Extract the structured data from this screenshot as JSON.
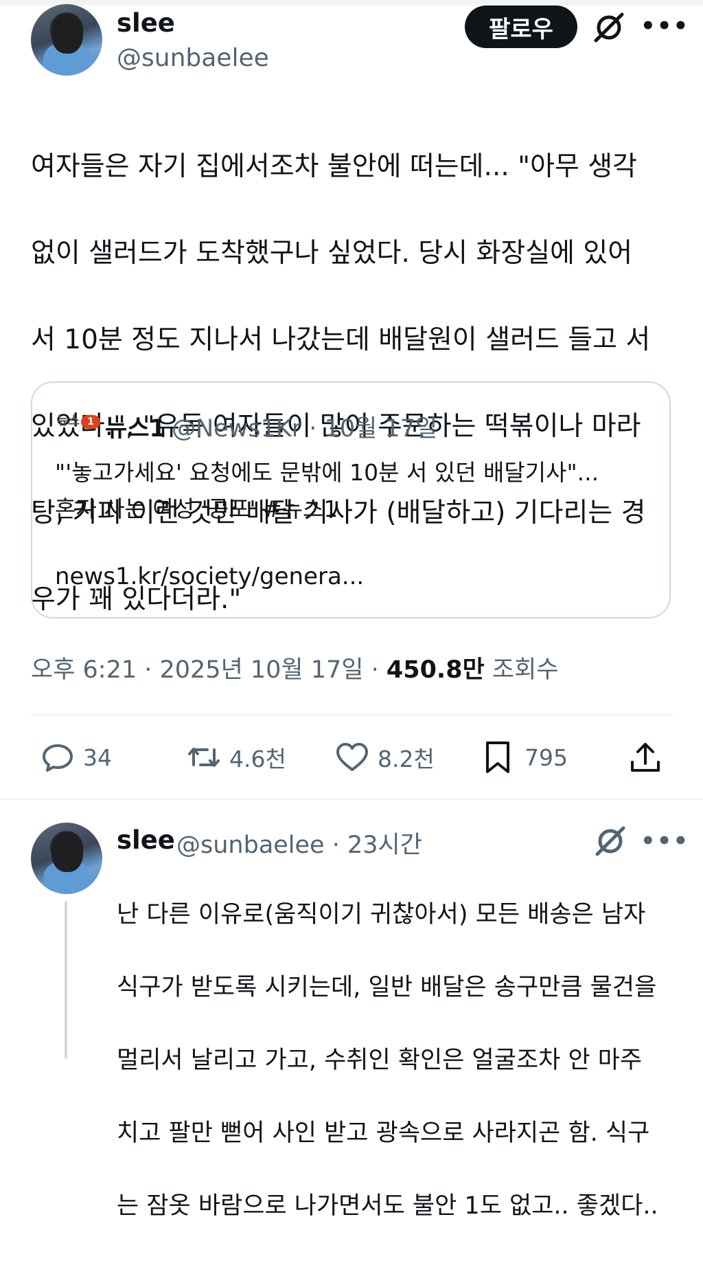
{
  "main_tweet": {
    "display_name": "slee",
    "handle": "@sunbaelee",
    "follow_label": "팔로우",
    "more_label": "•••",
    "text_lines": [
      "여자들은 자기 집에서조차 불안에 떠는데... \"아무 생각",
      "없이 샐러드가 도착했구나 싶었다. 당시 화장실에 있어",
      "서 10분 정도 지나서 나갔는데 배달원이 샐러드 들고 서",
      "있었다.\", \"유독 여자들이 많이 주문하는 떡볶이나 마라",
      "탕, 커피 이런 것만 배달 기사가 (배달하고) 기다리는 경",
      "우가 꽤 있다더라.\""
    ]
  },
  "quote": {
    "logo_text": "뉴스",
    "logo_badge": "1",
    "name": "뉴스1",
    "meta": "@News1Kr · 10월 17일",
    "text_line1": "\"'놓고가세요' 요청에도 문밖에 10분 서 있던 배달기사\"...",
    "text_line2": "혼자 사는 여성 '공포' #뉴스1",
    "link": "news1.kr/society/genera..."
  },
  "meta": {
    "time": "오후 6:21 · 2025년 10월 17일 · ",
    "views": "450.8만",
    "views_label": " 조회수"
  },
  "actions": {
    "replies": "34",
    "retweets": "4.6천",
    "likes": "8.2천",
    "bookmarks": "795"
  },
  "reply": {
    "display_name": "slee",
    "handle_time": "@sunbaelee · 23시간",
    "more_label": "•••",
    "text_lines": [
      "난 다른 이유로(움직이기 귀찮아서) 모든 배송은 남자",
      "식구가 받도록 시키는데, 일반 배달은 송구만큼 물건을",
      "멀리서 날리고 가고, 수취인 확인은 얼굴조차 안 마주",
      "치고 팔만 뻗어 사인 받고 광속으로 사라지곤 함. 식구",
      "는 잠옷 바람으로 나가면서도 불안 1도 없고.. 좋겠다.."
    ]
  },
  "icons": [
    "grok-icon",
    "more-icon",
    "reply-icon",
    "retweet-icon",
    "like-icon",
    "bookmark-icon",
    "share-icon"
  ]
}
